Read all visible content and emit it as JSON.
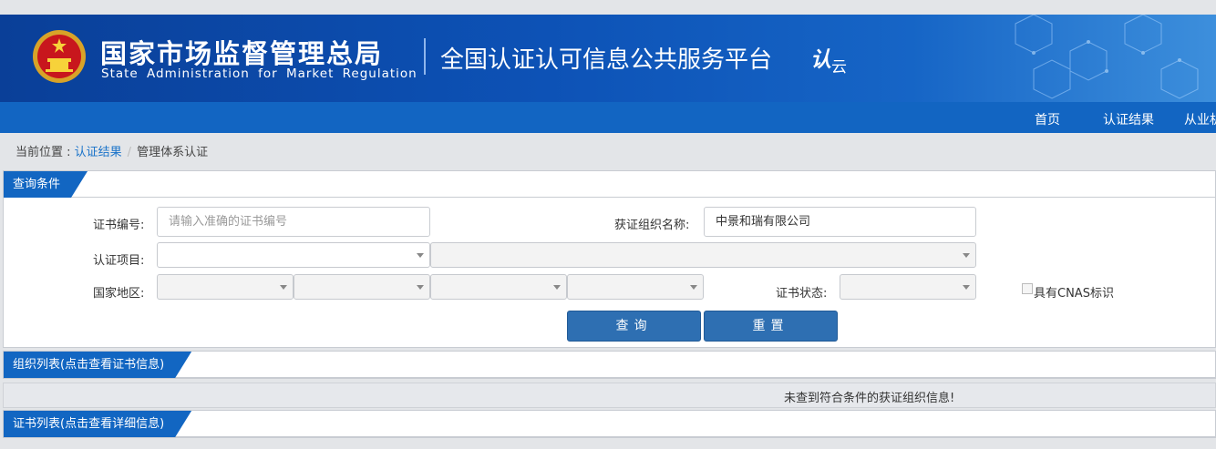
{
  "header": {
    "org_name_cn": "国家市场监督管理总局",
    "org_name_en": "State Administration for Market Regulation",
    "platform_title": "全国认证认可信息公共服务平台",
    "logo_text": "认",
    "logo_sub": "云"
  },
  "nav": {
    "items": [
      {
        "label": "首页"
      },
      {
        "label": "认证结果"
      },
      {
        "label": "从业机"
      }
    ]
  },
  "breadcrumb": {
    "prefix": "当前位置 :",
    "link": "认证结果",
    "separator": "/",
    "current": "管理体系认证"
  },
  "query": {
    "title": "查询条件",
    "cert_no_label": "证书编号:",
    "cert_no_placeholder": "请输入准确的证书编号",
    "org_name_label": "获证组织名称:",
    "org_name_value": "中景和瑞有限公司",
    "project_label": "认证项目:",
    "region_label": "国家地区:",
    "status_label": "证书状态:",
    "cnas_label": "具有CNAS标识",
    "search_button": "查询",
    "reset_button": "重置"
  },
  "org_list": {
    "title": "组织列表(点击查看证书信息)",
    "empty_message": "未查到符合条件的获证组织信息!"
  },
  "cert_list": {
    "title": "证书列表(点击查看详细信息)"
  },
  "colors": {
    "banner": "#0d52b6",
    "navbar": "#1265c2",
    "tab": "#1266c2",
    "button": "#2e6fb2",
    "link": "#1a73c9"
  },
  "icons": {
    "emblem": "national-emblem-icon",
    "dropdown": "chevron-down-icon"
  }
}
